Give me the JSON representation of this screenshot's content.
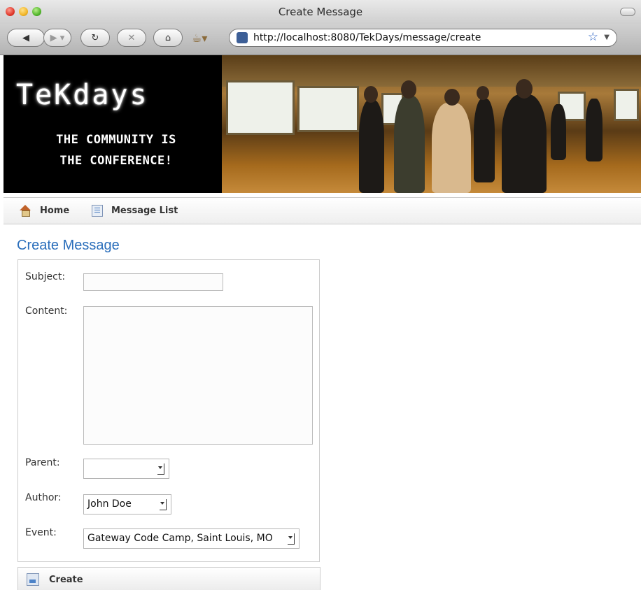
{
  "window": {
    "title": "Create Message"
  },
  "toolbar": {
    "url": "http://localhost:8080/TekDays/message/create",
    "icons": [
      "back-icon",
      "forward-icon",
      "reload-icon",
      "stop-icon",
      "home-icon",
      "coffee-icon",
      "site-icon",
      "star-icon"
    ]
  },
  "banner": {
    "logo": "TeKdays",
    "tagline_line1": "THE COMMUNITY IS",
    "tagline_line2": "THE CONFERENCE!"
  },
  "nav": {
    "home_label": "Home",
    "message_list_label": "Message List"
  },
  "page": {
    "title": "Create Message"
  },
  "form": {
    "subject_label": "Subject:",
    "subject_value": "",
    "content_label": "Content:",
    "content_value": "",
    "parent_label": "Parent:",
    "parent_value": "",
    "author_label": "Author:",
    "author_value": "John Doe",
    "event_label": "Event:",
    "event_value": "Gateway Code Camp, Saint Louis, MO"
  },
  "actions": {
    "create_label": "Create"
  }
}
